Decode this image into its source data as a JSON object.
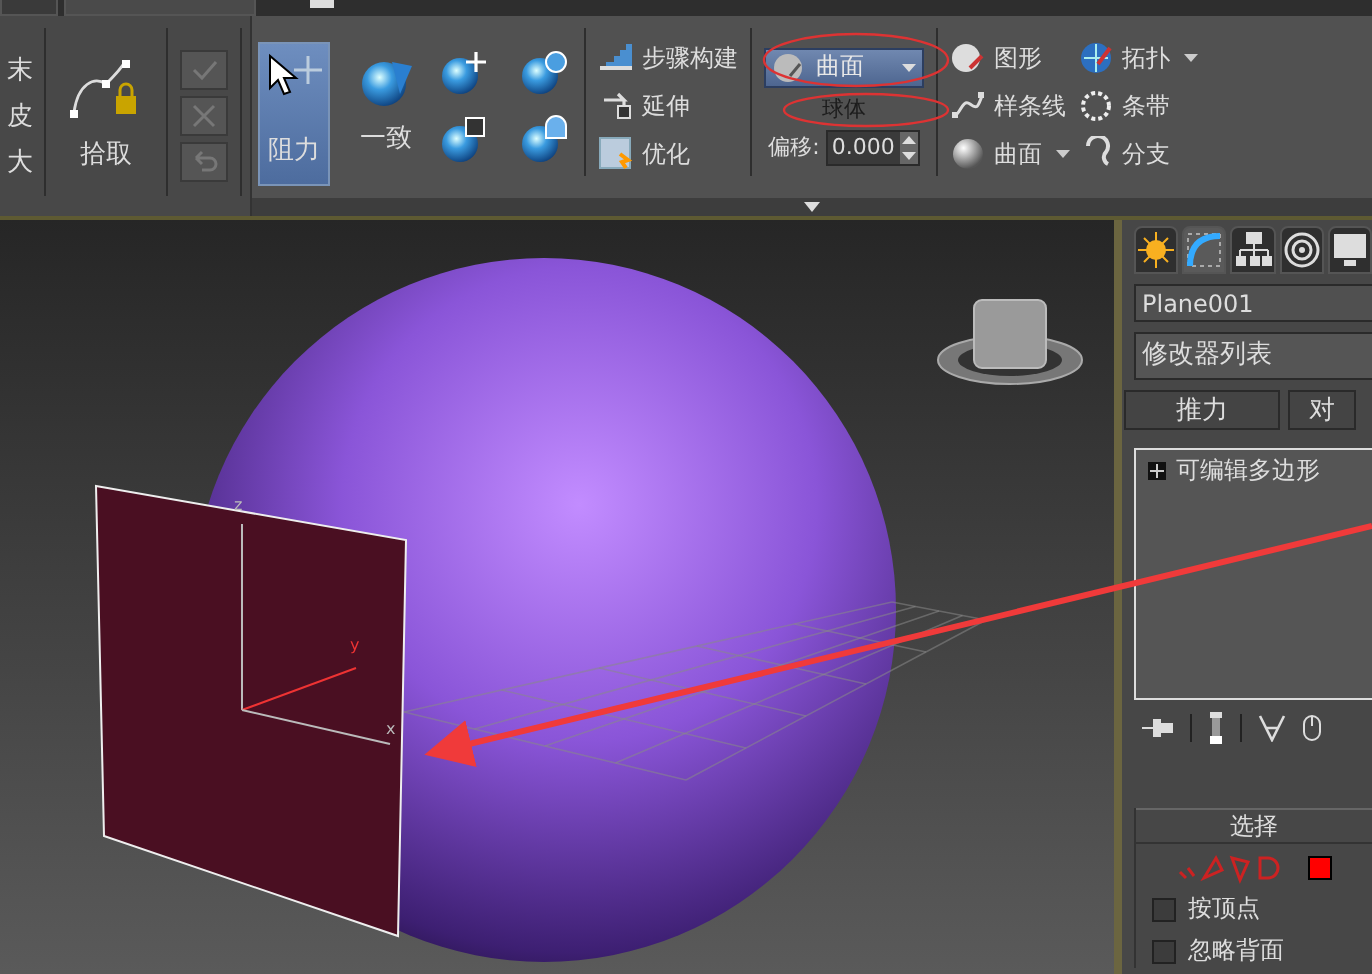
{
  "ribbon": {
    "cut_labels": [
      "末",
      "皮",
      "大"
    ],
    "pick": {
      "label": "拾取"
    },
    "small_buttons": [
      {
        "kind": "confirm",
        "disabled": true
      },
      {
        "kind": "cancel",
        "disabled": true
      },
      {
        "kind": "undo",
        "disabled": true
      }
    ],
    "drag_button": {
      "label": "阻力",
      "selected": true
    },
    "conform": {
      "label": "一致",
      "tools": [
        {
          "kind": "move"
        },
        {
          "kind": "rotate"
        },
        {
          "kind": "scale"
        },
        {
          "kind": "relax"
        }
      ]
    },
    "step_tools": [
      {
        "kind": "steps",
        "label": "步骤构建"
      },
      {
        "kind": "extend",
        "label": "延伸"
      },
      {
        "kind": "optimize",
        "label": "优化"
      }
    ],
    "surface_dropdown": {
      "value": "曲面"
    },
    "target_label": "球体",
    "offset": {
      "label": "偏移:",
      "value": "0.000"
    },
    "draw_tools": [
      {
        "kind": "shapes",
        "label": "图形",
        "has_menu": false
      },
      {
        "kind": "splines",
        "label": "样条线",
        "has_menu": false
      },
      {
        "kind": "surface",
        "label": "曲面",
        "has_menu": true
      }
    ],
    "topo_tools": [
      {
        "kind": "topology",
        "label": "拓扑",
        "has_menu": true
      },
      {
        "kind": "strips",
        "label": "条带",
        "has_menu": false
      },
      {
        "kind": "branches",
        "label": "分支",
        "has_menu": false
      }
    ]
  },
  "viewport": {
    "axis_labels": [
      "z",
      "y",
      "x"
    ]
  },
  "command_panel": {
    "tabs": [
      {
        "kind": "create",
        "selected": false
      },
      {
        "kind": "modify",
        "selected": true
      },
      {
        "kind": "hierarchy",
        "selected": false
      },
      {
        "kind": "motion",
        "selected": false
      },
      {
        "kind": "display",
        "selected": false
      }
    ],
    "object_name": "Plane001",
    "modifier_list": "修改器列表",
    "buttons": [
      "推力",
      "对"
    ],
    "stack": [
      {
        "label": "可编辑多边形",
        "expanded": false
      }
    ],
    "selection": {
      "title": "选择",
      "options": [
        {
          "label": "按顶点",
          "checked": false
        },
        {
          "label": "忽略背面",
          "checked": false
        }
      ]
    }
  }
}
